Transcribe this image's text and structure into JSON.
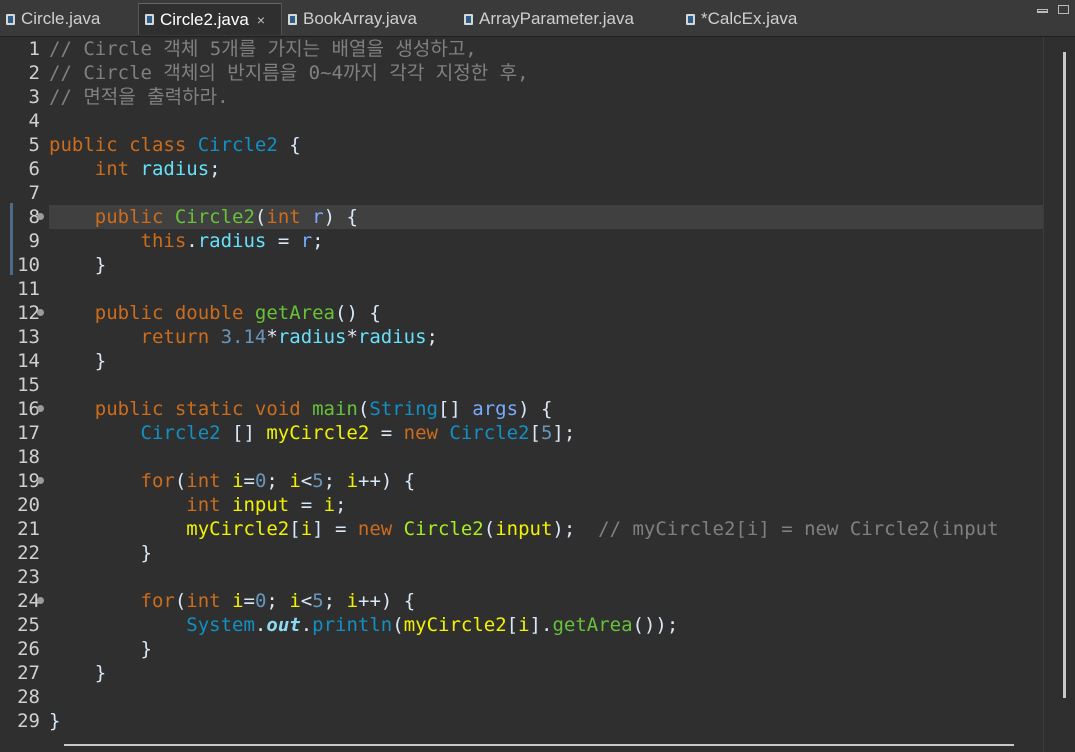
{
  "tabs": [
    {
      "label": "Circle.java",
      "active": false
    },
    {
      "label": "Circle2.java",
      "active": true,
      "close": "×"
    },
    {
      "label": "BookArray.java",
      "active": false
    },
    {
      "label": "ArrayParameter.java",
      "active": false
    },
    {
      "label": "*CalcEx.java",
      "active": false
    }
  ],
  "editor": {
    "current_line": 8,
    "fold_lines": [
      8,
      12,
      16,
      19,
      24
    ],
    "lines": [
      {
        "num": "1",
        "tokens": [
          {
            "t": "comment",
            "v": "// Circle 객체 5개를 가지는 배열을 생성하고,"
          }
        ]
      },
      {
        "num": "2",
        "tokens": [
          {
            "t": "comment",
            "v": "// Circle 객체의 반지름을 0~4까지 각각 지정한 후,"
          }
        ]
      },
      {
        "num": "3",
        "tokens": [
          {
            "t": "comment",
            "v": "// 면적을 출력하라."
          }
        ]
      },
      {
        "num": "4",
        "tokens": []
      },
      {
        "num": "5",
        "tokens": [
          {
            "t": "keyword",
            "v": "public class "
          },
          {
            "t": "type",
            "v": "Circle2"
          },
          {
            "t": "plain",
            "v": " {"
          }
        ]
      },
      {
        "num": "6",
        "tokens": [
          {
            "t": "plain",
            "v": "    "
          },
          {
            "t": "keyword",
            "v": "int "
          },
          {
            "t": "field",
            "v": "radius"
          },
          {
            "t": "plain",
            "v": ";"
          }
        ]
      },
      {
        "num": "7",
        "tokens": []
      },
      {
        "num": "8",
        "tokens": [
          {
            "t": "plain",
            "v": "    "
          },
          {
            "t": "keyword",
            "v": "public "
          },
          {
            "t": "method",
            "v": "Circle2"
          },
          {
            "t": "plain",
            "v": "("
          },
          {
            "t": "keyword",
            "v": "int "
          },
          {
            "t": "param",
            "v": "r"
          },
          {
            "t": "plain",
            "v": ") {"
          }
        ]
      },
      {
        "num": "9",
        "tokens": [
          {
            "t": "plain",
            "v": "        "
          },
          {
            "t": "keyword",
            "v": "this"
          },
          {
            "t": "plain",
            "v": "."
          },
          {
            "t": "field",
            "v": "radius"
          },
          {
            "t": "plain",
            "v": " = "
          },
          {
            "t": "param",
            "v": "r"
          },
          {
            "t": "plain",
            "v": ";"
          }
        ]
      },
      {
        "num": "10",
        "tokens": [
          {
            "t": "plain",
            "v": "    }"
          }
        ]
      },
      {
        "num": "11",
        "tokens": []
      },
      {
        "num": "12",
        "tokens": [
          {
            "t": "plain",
            "v": "    "
          },
          {
            "t": "keyword",
            "v": "public double "
          },
          {
            "t": "method",
            "v": "getArea"
          },
          {
            "t": "plain",
            "v": "() {"
          }
        ]
      },
      {
        "num": "13",
        "tokens": [
          {
            "t": "plain",
            "v": "        "
          },
          {
            "t": "keyword",
            "v": "return "
          },
          {
            "t": "number",
            "v": "3.14"
          },
          {
            "t": "ops",
            "v": "*"
          },
          {
            "t": "field",
            "v": "radius"
          },
          {
            "t": "ops",
            "v": "*"
          },
          {
            "t": "field",
            "v": "radius"
          },
          {
            "t": "plain",
            "v": ";"
          }
        ]
      },
      {
        "num": "14",
        "tokens": [
          {
            "t": "plain",
            "v": "    }"
          }
        ]
      },
      {
        "num": "15",
        "tokens": []
      },
      {
        "num": "16",
        "tokens": [
          {
            "t": "plain",
            "v": "    "
          },
          {
            "t": "keyword",
            "v": "public static void "
          },
          {
            "t": "method",
            "v": "main"
          },
          {
            "t": "plain",
            "v": "("
          },
          {
            "t": "type",
            "v": "String"
          },
          {
            "t": "plain",
            "v": "[] "
          },
          {
            "t": "param",
            "v": "args"
          },
          {
            "t": "plain",
            "v": ") {"
          }
        ]
      },
      {
        "num": "17",
        "tokens": [
          {
            "t": "plain",
            "v": "        "
          },
          {
            "t": "type",
            "v": "Circle2"
          },
          {
            "t": "plain",
            "v": " [] "
          },
          {
            "t": "local",
            "v": "myCircle2"
          },
          {
            "t": "plain",
            "v": " = "
          },
          {
            "t": "keyword",
            "v": "new "
          },
          {
            "t": "type",
            "v": "Circle2"
          },
          {
            "t": "plain",
            "v": "["
          },
          {
            "t": "number",
            "v": "5"
          },
          {
            "t": "plain",
            "v": "];"
          }
        ]
      },
      {
        "num": "18",
        "tokens": []
      },
      {
        "num": "19",
        "tokens": [
          {
            "t": "plain",
            "v": "        "
          },
          {
            "t": "keyword",
            "v": "for"
          },
          {
            "t": "plain",
            "v": "("
          },
          {
            "t": "keyword",
            "v": "int "
          },
          {
            "t": "local",
            "v": "i"
          },
          {
            "t": "plain",
            "v": "="
          },
          {
            "t": "number",
            "v": "0"
          },
          {
            "t": "plain",
            "v": "; "
          },
          {
            "t": "local",
            "v": "i"
          },
          {
            "t": "plain",
            "v": "<"
          },
          {
            "t": "number",
            "v": "5"
          },
          {
            "t": "plain",
            "v": "; "
          },
          {
            "t": "local",
            "v": "i"
          },
          {
            "t": "plain",
            "v": "++) {"
          }
        ]
      },
      {
        "num": "20",
        "tokens": [
          {
            "t": "plain",
            "v": "            "
          },
          {
            "t": "keyword",
            "v": "int "
          },
          {
            "t": "local",
            "v": "input"
          },
          {
            "t": "plain",
            "v": " = "
          },
          {
            "t": "local",
            "v": "i"
          },
          {
            "t": "plain",
            "v": ";"
          }
        ]
      },
      {
        "num": "21",
        "tokens": [
          {
            "t": "plain",
            "v": "            "
          },
          {
            "t": "local",
            "v": "myCircle2"
          },
          {
            "t": "plain",
            "v": "["
          },
          {
            "t": "local",
            "v": "i"
          },
          {
            "t": "plain",
            "v": "] = "
          },
          {
            "t": "keyword",
            "v": "new "
          },
          {
            "t": "method2",
            "v": "Circle2"
          },
          {
            "t": "plain",
            "v": "("
          },
          {
            "t": "local",
            "v": "input"
          },
          {
            "t": "plain",
            "v": ");  "
          },
          {
            "t": "comment",
            "v": "// myCircle2[i] = new Circle2(input"
          }
        ]
      },
      {
        "num": "22",
        "tokens": [
          {
            "t": "plain",
            "v": "        }"
          }
        ]
      },
      {
        "num": "23",
        "tokens": []
      },
      {
        "num": "24",
        "tokens": [
          {
            "t": "plain",
            "v": "        "
          },
          {
            "t": "keyword",
            "v": "for"
          },
          {
            "t": "plain",
            "v": "("
          },
          {
            "t": "keyword",
            "v": "int "
          },
          {
            "t": "local",
            "v": "i"
          },
          {
            "t": "plain",
            "v": "="
          },
          {
            "t": "number",
            "v": "0"
          },
          {
            "t": "plain",
            "v": "; "
          },
          {
            "t": "local",
            "v": "i"
          },
          {
            "t": "plain",
            "v": "<"
          },
          {
            "t": "number",
            "v": "5"
          },
          {
            "t": "plain",
            "v": "; "
          },
          {
            "t": "local",
            "v": "i"
          },
          {
            "t": "plain",
            "v": "++) {"
          }
        ]
      },
      {
        "num": "25",
        "tokens": [
          {
            "t": "plain",
            "v": "            "
          },
          {
            "t": "type",
            "v": "System"
          },
          {
            "t": "plain",
            "v": "."
          },
          {
            "t": "static",
            "v": "out"
          },
          {
            "t": "plain",
            "v": "."
          },
          {
            "t": "type",
            "v": "println"
          },
          {
            "t": "plain",
            "v": "("
          },
          {
            "t": "local",
            "v": "myCircle2"
          },
          {
            "t": "plain",
            "v": "["
          },
          {
            "t": "local",
            "v": "i"
          },
          {
            "t": "plain",
            "v": "]."
          },
          {
            "t": "method",
            "v": "getArea"
          },
          {
            "t": "plain",
            "v": "());"
          }
        ]
      },
      {
        "num": "26",
        "tokens": [
          {
            "t": "plain",
            "v": "        }"
          }
        ]
      },
      {
        "num": "27",
        "tokens": [
          {
            "t": "plain",
            "v": "    }"
          }
        ]
      },
      {
        "num": "28",
        "tokens": []
      },
      {
        "num": "29",
        "tokens": [
          {
            "t": "plain",
            "v": "}"
          }
        ]
      }
    ]
  }
}
